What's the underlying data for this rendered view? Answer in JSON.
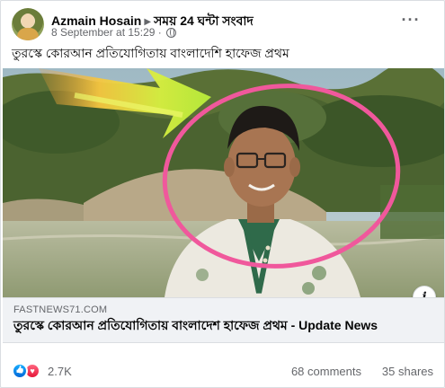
{
  "post": {
    "author": "Azmain Hosain",
    "group": "সময় 24 ঘন্টা সংবাদ",
    "timestamp": "8 September at 15:29",
    "more_icon": "more-horizontal-icon",
    "caption": "তুরস্কে কোরআন প্রতিযোগিতায় বাংলাদেশি হাফেজ প্রথম"
  },
  "link_card": {
    "domain": "FASTNEWS71.COM",
    "title": "তুরস্কে কোরআন প্রতিযোগিতায় বাংলাদেশ হাফেজ প্রথম - Update News",
    "info_label": "i",
    "annotation_colors": {
      "circle": "#f0589c",
      "arrow": "#c8f03c",
      "arrow_glow": "#f4a33a"
    }
  },
  "stats": {
    "reaction_count": "2.7K",
    "comments": "68 comments",
    "shares": "35 shares",
    "reactions": [
      "like",
      "love"
    ]
  }
}
